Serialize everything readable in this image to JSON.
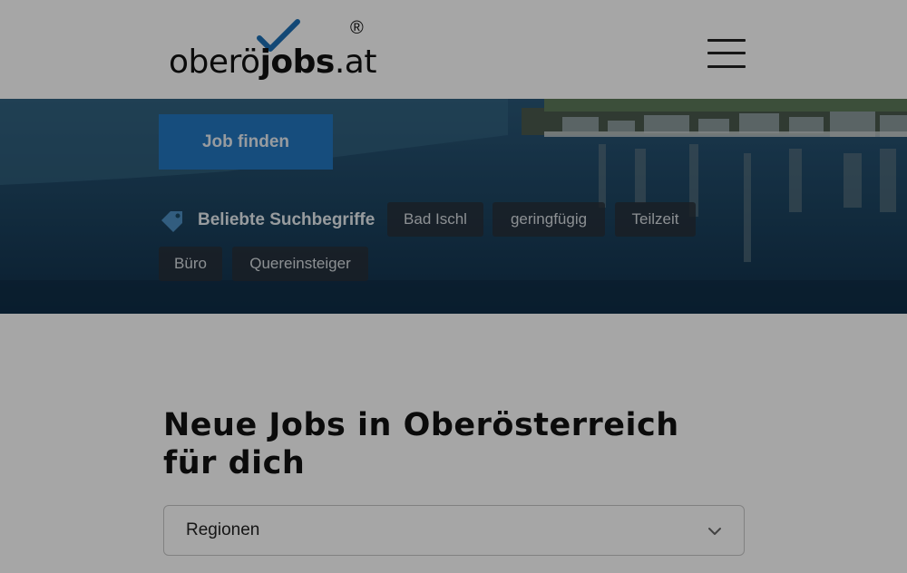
{
  "header": {
    "logo_text_regular": "oberö",
    "logo_text_bold": "jobs",
    "logo_text_suffix": ".at",
    "logo_registered": "®",
    "menu_icon": "hamburger-menu-icon"
  },
  "hero": {
    "find_button_label": "Job finden",
    "popular_label": "Beliebte Suchbegriffe",
    "popular_icon": "tag-icon",
    "chips": [
      "Bad Ischl",
      "geringfügig",
      "Teilzeit",
      "Büro",
      "Quereinsteiger"
    ]
  },
  "main": {
    "title": "Neue Jobs in Oberösterreich für dich",
    "region_select": {
      "selected": "Regionen",
      "icon": "chevron-down-icon"
    }
  },
  "colors": {
    "accent": "#2277c0",
    "check": "#1d6fb5",
    "overlay": "rgba(0,0,0,0.35)"
  }
}
